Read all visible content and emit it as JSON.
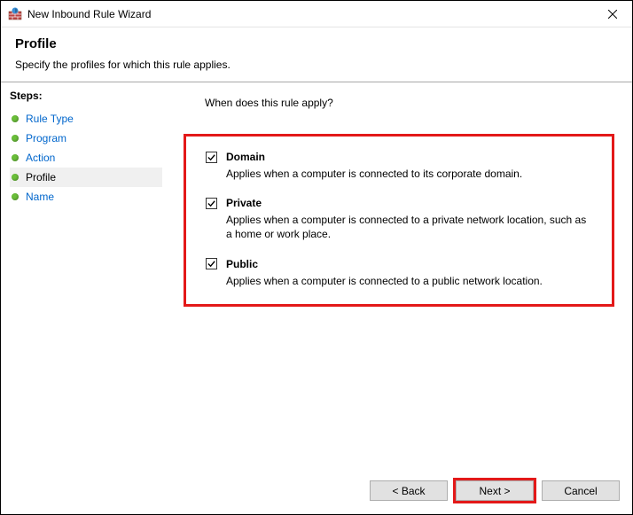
{
  "window": {
    "title": "New Inbound Rule Wizard"
  },
  "header": {
    "title": "Profile",
    "subtitle": "Specify the profiles for which this rule applies."
  },
  "sidebar": {
    "label": "Steps:",
    "items": [
      {
        "label": "Rule Type"
      },
      {
        "label": "Program"
      },
      {
        "label": "Action"
      },
      {
        "label": "Profile"
      },
      {
        "label": "Name"
      }
    ]
  },
  "main": {
    "question": "When does this rule apply?",
    "options": [
      {
        "title": "Domain",
        "desc": "Applies when a computer is connected to its corporate domain."
      },
      {
        "title": "Private",
        "desc": "Applies when a computer is connected to a private network location, such as a home or work place."
      },
      {
        "title": "Public",
        "desc": "Applies when a computer is connected to a public network location."
      }
    ]
  },
  "footer": {
    "back": "< Back",
    "next": "Next >",
    "cancel": "Cancel"
  }
}
